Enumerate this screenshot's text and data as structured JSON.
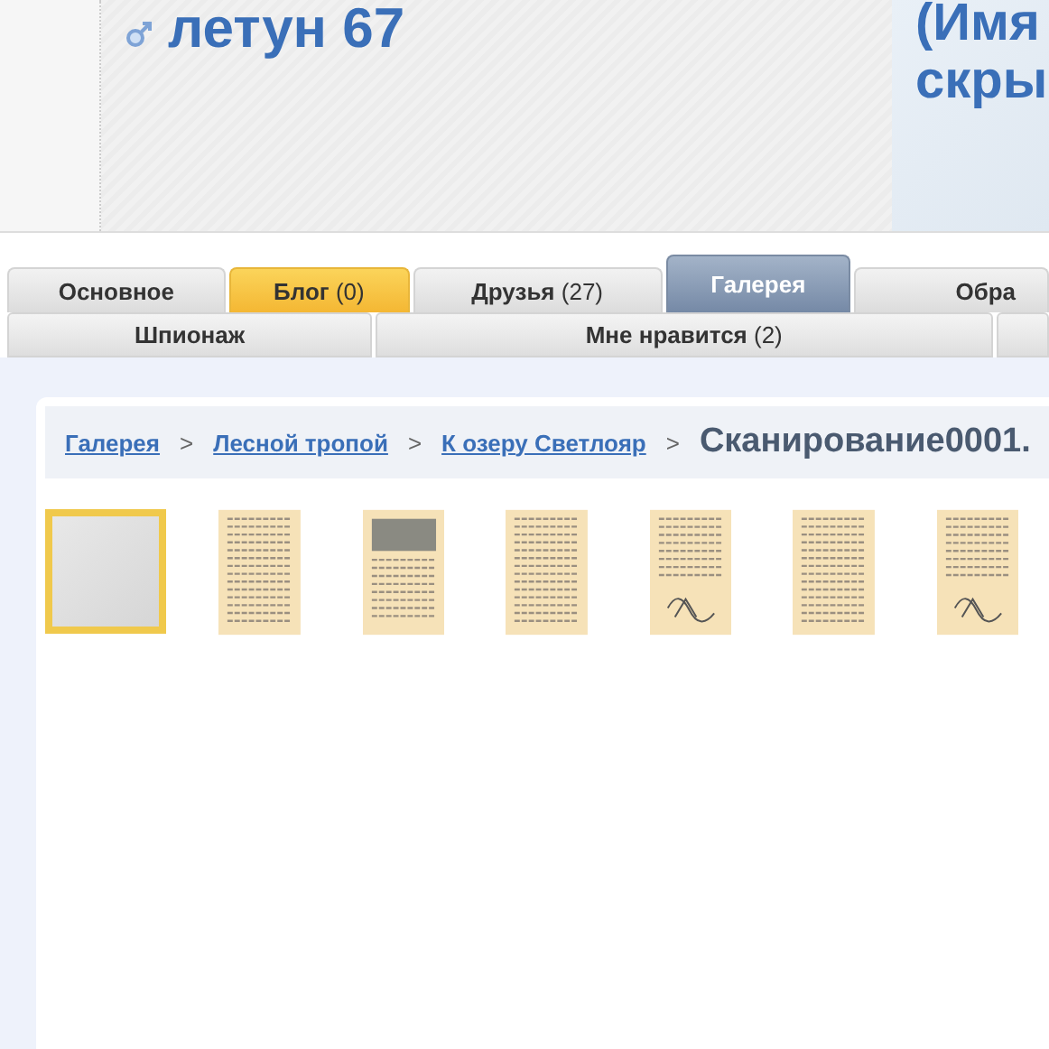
{
  "profile": {
    "name": "летун 67",
    "side_lines": [
      "(Имя",
      "скры"
    ]
  },
  "tabs": [
    {
      "label": "Основное",
      "selected": false,
      "highlighted": false
    },
    {
      "label": "Блог",
      "count": "(0)",
      "selected": false,
      "highlighted": true
    },
    {
      "label": "Друзья",
      "count": "(27)",
      "selected": false,
      "highlighted": false
    },
    {
      "label": "Галерея",
      "selected": true,
      "highlighted": false
    },
    {
      "label": "Обра",
      "selected": false,
      "highlighted": false
    }
  ],
  "subtabs": [
    {
      "label": "Шпионаж"
    },
    {
      "label": "Мне нравится",
      "count": "(2)"
    }
  ],
  "breadcrumb": {
    "links": [
      "Галерея",
      "Лесной тропой",
      "К озеру Светлояр"
    ],
    "separator": ">",
    "current": "Сканирование0001."
  },
  "thumbnails": [
    {
      "kind": "blank",
      "selected": true
    },
    {
      "kind": "text",
      "selected": false
    },
    {
      "kind": "photo",
      "selected": false
    },
    {
      "kind": "text",
      "selected": false
    },
    {
      "kind": "sketch",
      "selected": false
    },
    {
      "kind": "text",
      "selected": false
    },
    {
      "kind": "sketch",
      "selected": false
    }
  ]
}
